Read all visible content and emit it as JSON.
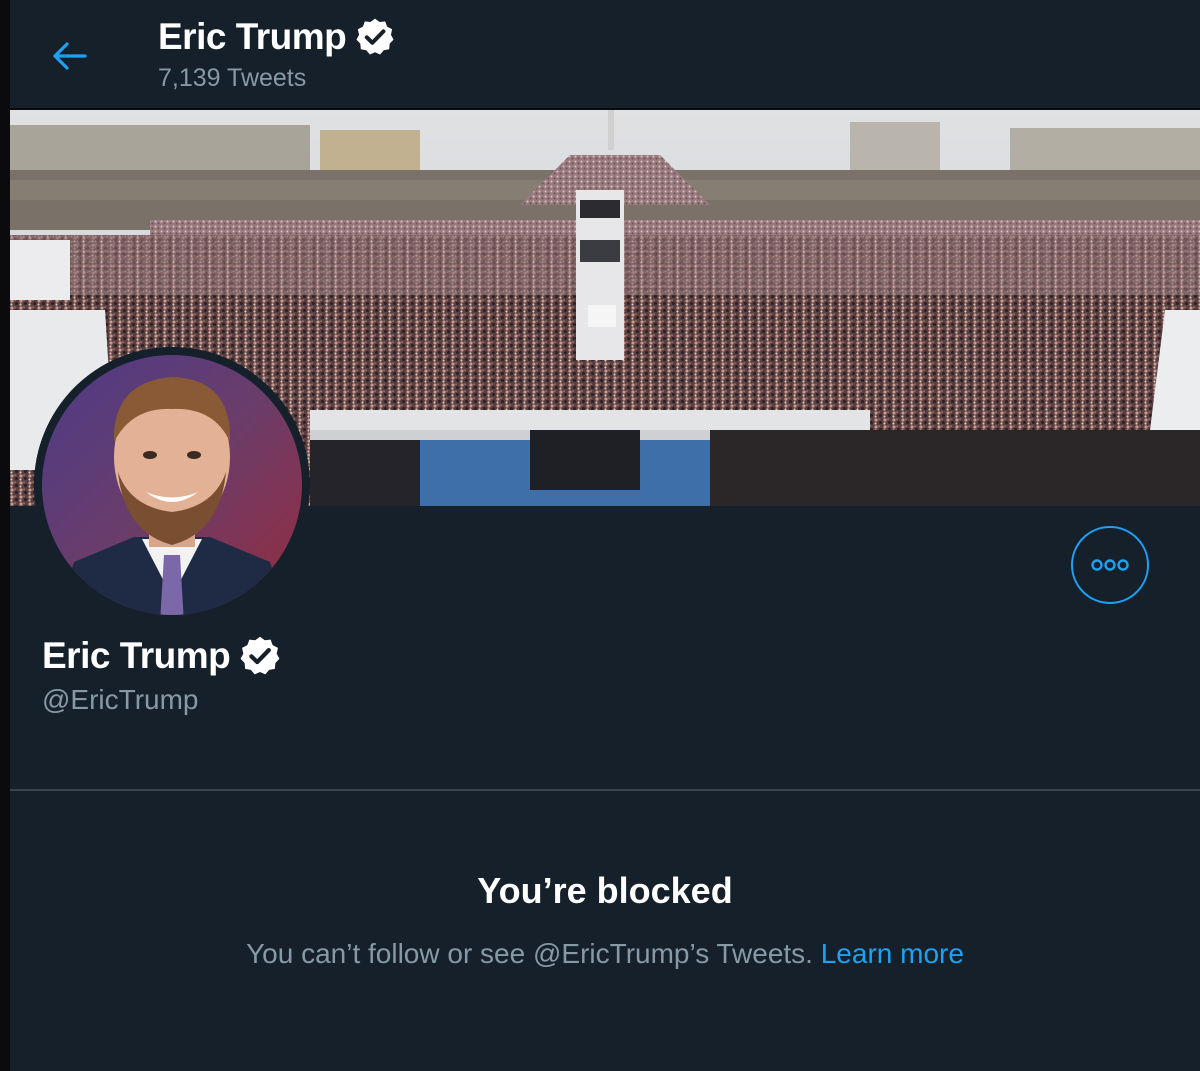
{
  "header": {
    "back_icon": "arrow-left-icon",
    "name": "Eric Trump",
    "verified_icon": "verified-badge-icon",
    "tweet_count": "7,139 Tweets"
  },
  "banner": {
    "description": "Cover photo of a large crowd gathered on the National Mall"
  },
  "profile": {
    "avatar_icon": "avatar",
    "name": "Eric Trump",
    "verified_icon": "verified-badge-icon",
    "handle": "@EricTrump",
    "more_icon": "more-options-icon"
  },
  "blocked": {
    "title": "You’re blocked",
    "message": "You can’t follow or see @EricTrump’s Tweets.",
    "link": "Learn more"
  },
  "colors": {
    "background": "#15202b",
    "accent": "#1da1f2",
    "secondary_text": "#8899a6",
    "divider": "#38444d"
  }
}
